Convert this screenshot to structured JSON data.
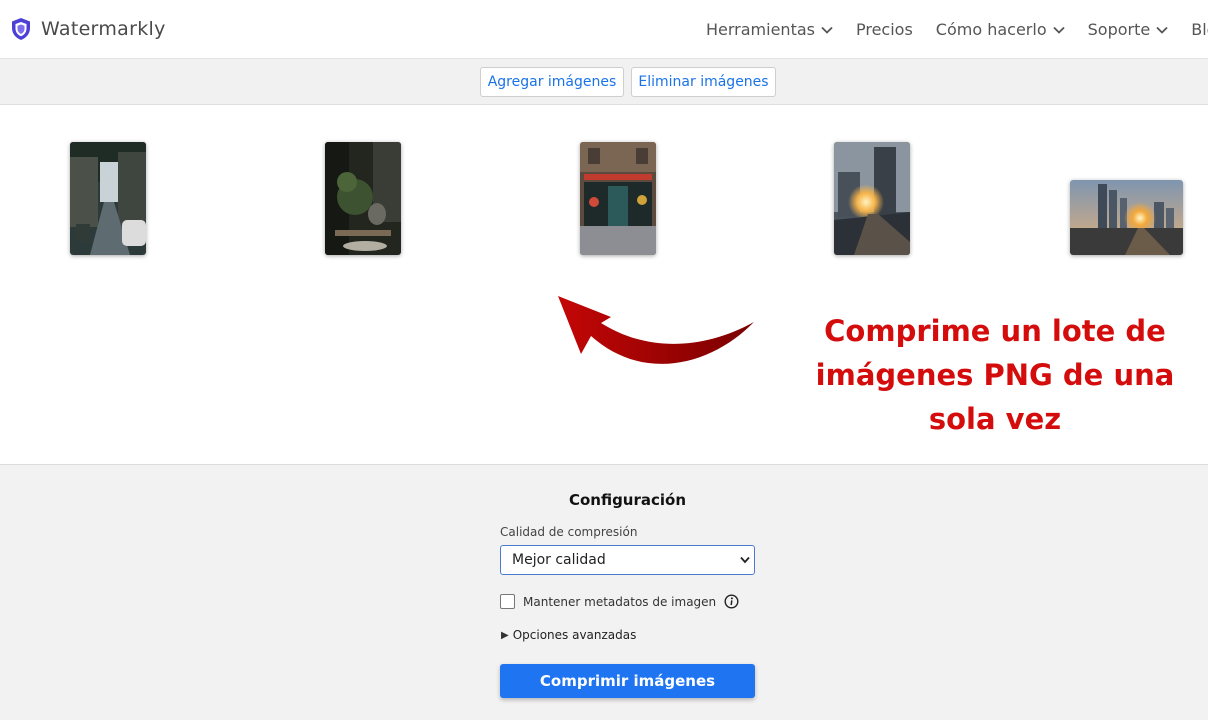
{
  "brand": {
    "name": "Watermarkly",
    "logo_icon": "shield-icon",
    "logo_color": "#4b3fd6"
  },
  "nav": [
    {
      "label": "Herramientas",
      "dropdown": true
    },
    {
      "label": "Precios",
      "dropdown": false
    },
    {
      "label": "Cómo hacerlo",
      "dropdown": true
    },
    {
      "label": "Soporte",
      "dropdown": true
    },
    {
      "label": "Blog",
      "dropdown": false
    }
  ],
  "toolbar": {
    "add_label": "Agregar imágenes",
    "remove_label": "Eliminar imágenes"
  },
  "gallery": [
    {
      "name": "photo-street",
      "orientation": "portrait"
    },
    {
      "name": "photo-cafe",
      "orientation": "portrait"
    },
    {
      "name": "photo-storefront",
      "orientation": "portrait"
    },
    {
      "name": "photo-sunset-city",
      "orientation": "portrait"
    },
    {
      "name": "photo-skyline",
      "orientation": "landscape"
    }
  ],
  "annotation": {
    "text": "Comprime un lote de imágenes PNG de una sola vez",
    "color": "#d40c0c"
  },
  "config": {
    "title": "Configuración",
    "quality_label": "Calidad de compresión",
    "quality_value": "Mejor calidad",
    "metadata_label": "Mantener metadatos de imagen",
    "metadata_checked": false,
    "advanced_label": "Opciones avanzadas",
    "submit_label": "Comprimir imágenes",
    "accent": "#1f74f2"
  }
}
